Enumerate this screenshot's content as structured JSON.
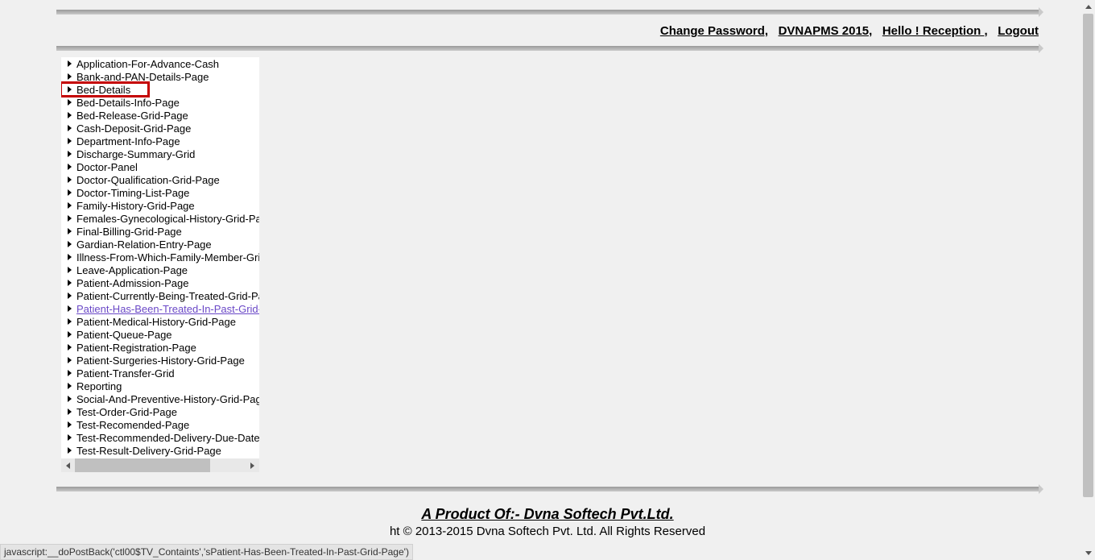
{
  "topbar": {
    "change_password": "Change Password,",
    "app_title": "DVNAPMS 2015,",
    "greeting": "Hello ! Reception ,",
    "logout": "Logout"
  },
  "tree": {
    "items": [
      {
        "label": "Application-For-Advance-Cash"
      },
      {
        "label": "Bank-and-PAN-Details-Page"
      },
      {
        "label": "Bed-Details",
        "highlighted": true
      },
      {
        "label": "Bed-Details-Info-Page"
      },
      {
        "label": "Bed-Release-Grid-Page"
      },
      {
        "label": "Cash-Deposit-Grid-Page"
      },
      {
        "label": "Department-Info-Page"
      },
      {
        "label": "Discharge-Summary-Grid"
      },
      {
        "label": "Doctor-Panel"
      },
      {
        "label": "Doctor-Qualification-Grid-Page"
      },
      {
        "label": "Doctor-Timing-List-Page"
      },
      {
        "label": "Family-History-Grid-Page"
      },
      {
        "label": "Females-Gynecological-History-Grid-Page"
      },
      {
        "label": "Final-Billing-Grid-Page"
      },
      {
        "label": "Gardian-Relation-Entry-Page"
      },
      {
        "label": "Illness-From-Which-Family-Member-Grid"
      },
      {
        "label": "Leave-Application-Page"
      },
      {
        "label": "Patient-Admission-Page"
      },
      {
        "label": "Patient-Currently-Being-Treated-Grid-Page"
      },
      {
        "label": "Patient-Has-Been-Treated-In-Past-Grid-Page",
        "hovered": true
      },
      {
        "label": "Patient-Medical-History-Grid-Page"
      },
      {
        "label": "Patient-Queue-Page"
      },
      {
        "label": "Patient-Registration-Page"
      },
      {
        "label": "Patient-Surgeries-History-Grid-Page"
      },
      {
        "label": "Patient-Transfer-Grid"
      },
      {
        "label": "Reporting"
      },
      {
        "label": "Social-And-Preventive-History-Grid-Page"
      },
      {
        "label": "Test-Order-Grid-Page"
      },
      {
        "label": "Test-Recomended-Page"
      },
      {
        "label": "Test-Recommended-Delivery-Due-Date"
      },
      {
        "label": "Test-Result-Delivery-Grid-Page"
      }
    ]
  },
  "footer": {
    "product": "A Product Of:- Dvna Softech Pvt.Ltd.",
    "copyright": "ht © 2013-2015 Dvna Softech Pvt. Ltd. All Rights Reserved"
  },
  "statusbar": {
    "text": "javascript:__doPostBack('ctl00$TV_Containts','sPatient-Has-Been-Treated-In-Past-Grid-Page')"
  }
}
